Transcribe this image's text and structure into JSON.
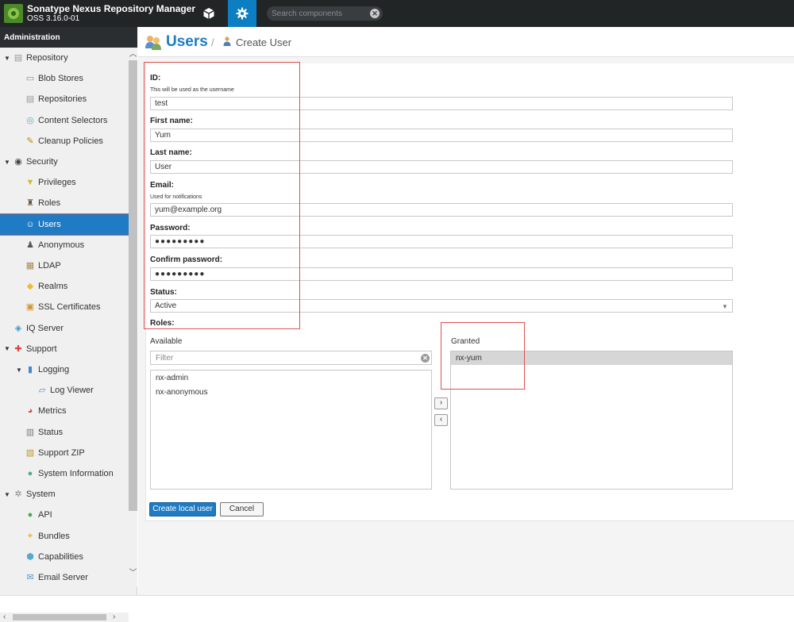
{
  "app": {
    "title": "Sonatype Nexus Repository Manager",
    "version": "OSS 3.16.0-01"
  },
  "topbar": {
    "browse_icon": "cube-icon",
    "admin_icon": "gear-icon",
    "search_placeholder": "Search components",
    "admin_active_color": "#0d7ec2"
  },
  "sidebar": {
    "header": "Administration",
    "items": [
      {
        "label": "Repository",
        "icon": "repository-icon",
        "level": 0,
        "expanded": true
      },
      {
        "label": "Blob Stores",
        "icon": "blob-store-icon",
        "level": 1
      },
      {
        "label": "Repositories",
        "icon": "repositories-icon",
        "level": 1
      },
      {
        "label": "Content Selectors",
        "icon": "content-selector-icon",
        "level": 1
      },
      {
        "label": "Cleanup Policies",
        "icon": "broom-icon",
        "level": 1
      },
      {
        "label": "Security",
        "icon": "eye-icon",
        "level": 0,
        "expanded": true
      },
      {
        "label": "Privileges",
        "icon": "medal-icon",
        "level": 1
      },
      {
        "label": "Roles",
        "icon": "role-icon",
        "level": 1
      },
      {
        "label": "Users",
        "icon": "users-icon",
        "level": 1,
        "selected": true
      },
      {
        "label": "Anonymous",
        "icon": "anonymous-icon",
        "level": 1
      },
      {
        "label": "LDAP",
        "icon": "ldap-icon",
        "level": 1
      },
      {
        "label": "Realms",
        "icon": "shield-icon",
        "level": 1
      },
      {
        "label": "SSL Certificates",
        "icon": "certificate-icon",
        "level": 1
      },
      {
        "label": "IQ Server",
        "icon": "iq-server-icon",
        "level": 0
      },
      {
        "label": "Support",
        "icon": "lifebuoy-icon",
        "level": 0,
        "expanded": true
      },
      {
        "label": "Logging",
        "icon": "book-icon",
        "level": 1,
        "expanded": true
      },
      {
        "label": "Log Viewer",
        "icon": "log-viewer-icon",
        "level": 2
      },
      {
        "label": "Metrics",
        "icon": "pie-chart-icon",
        "level": 1
      },
      {
        "label": "Status",
        "icon": "status-icon",
        "level": 1
      },
      {
        "label": "Support ZIP",
        "icon": "zip-icon",
        "level": 1
      },
      {
        "label": "System Information",
        "icon": "globe-icon",
        "level": 1
      },
      {
        "label": "System",
        "icon": "cog-icon",
        "level": 0,
        "expanded": true
      },
      {
        "label": "API",
        "icon": "api-icon",
        "level": 1
      },
      {
        "label": "Bundles",
        "icon": "bundles-icon",
        "level": 1
      },
      {
        "label": "Capabilities",
        "icon": "capabilities-icon",
        "level": 1
      },
      {
        "label": "Email Server",
        "icon": "email-icon",
        "level": 1
      }
    ]
  },
  "breadcrumb": {
    "title": "Users",
    "separator": "/",
    "sub": "Create User"
  },
  "form": {
    "id_label": "ID:",
    "id_hint": "This will be used as the username",
    "id_value": "test",
    "first_name_label": "First name:",
    "first_name_value": "Yum",
    "last_name_label": "Last name:",
    "last_name_value": "User",
    "email_label": "Email:",
    "email_hint": "Used for notifications",
    "email_value": "yum@example.org",
    "password_label": "Password:",
    "password_value": "●●●●●●●●●",
    "confirm_password_label": "Confirm password:",
    "confirm_password_value": "●●●●●●●●●",
    "status_label": "Status:",
    "status_value": "Active",
    "roles_label": "Roles:",
    "available_label": "Available",
    "filter_placeholder": "Filter",
    "available_roles": [
      "nx-admin",
      "nx-anonymous"
    ],
    "granted_label": "Granted",
    "granted_roles": [
      "nx-yum"
    ],
    "move_right": "›",
    "move_left": "‹",
    "create_button": "Create local user",
    "cancel_button": "Cancel"
  }
}
